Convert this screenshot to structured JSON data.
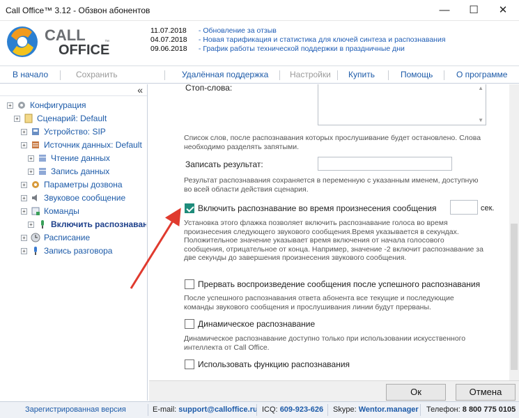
{
  "window": {
    "title": "Call Office™ 3.12 - Обзвон абонентов",
    "minimize_glyph": "—",
    "maximize_glyph": "☐",
    "close_glyph": "✕"
  },
  "logo": {
    "line1": "CALL",
    "line2": "OFFICE",
    "tm": "™"
  },
  "news": [
    {
      "date": "11.07.2018",
      "text": "Обновление за отзыв"
    },
    {
      "date": "04.07.2018",
      "text": "Новая тарификация и статистика для ключей синтеза и распознавания"
    },
    {
      "date": "09.06.2018",
      "text": "График работы технической поддержки в праздничные дни"
    }
  ],
  "menu": {
    "home": "В начало",
    "save": "Сохранить",
    "remote": "Удалённая поддержка",
    "settings": "Настройки",
    "buy": "Купить",
    "help": "Помощь",
    "about": "О программе"
  },
  "sidebar": {
    "collapse": "«",
    "items": [
      {
        "label": "Конфигурация"
      },
      {
        "label": "Сценарий: Default"
      },
      {
        "label": "Устройство: SIP"
      },
      {
        "label": "Источник данных: Default"
      },
      {
        "label": "Чтение данных"
      },
      {
        "label": "Запись данных"
      },
      {
        "label": "Параметры дозвона"
      },
      {
        "label": "Звуковое сообщение"
      },
      {
        "label": "Команды"
      },
      {
        "label": "Включить распознавание"
      },
      {
        "label": "Расписание"
      },
      {
        "label": "Запись разговора"
      }
    ]
  },
  "content": {
    "stopwords_label": "Стоп-слова:",
    "stopwords_help": "Список слов, после распознавания которых прослушивание будет остановлено. Слова необходимо разделять запятыми.",
    "write_result_label": "Записать результат:",
    "write_result_value": "",
    "write_result_help": "Результат распознавания сохраняется в переменную с указанным именем, доступную во всей области действия сценария.",
    "enable_label": "Включить распознавание во время произнесения сообщения",
    "enable_checked": true,
    "seconds_value": "",
    "seconds_unit": "сек.",
    "enable_help": "Установка этого флажка позволяет включить распознавание голоса во время произнесения следующего звукового сообщения.Время указывается в секундах. Положительное значение указывает время включения от начала голосового сообщения, отрицательное от конца. Например, значение -2 включит распознавание за две секунды до завершения произнесения звукового сообщения.",
    "interrupt_label": "Прервать воспроизведение сообщения после успешного распознавания",
    "interrupt_checked": false,
    "interrupt_help": "После успешного распознавания ответа абонента все текущие и последующие команды звукового сообщения и прослушивания линии будут прерваны.",
    "dynamic_label": "Динамическое распознавание",
    "dynamic_checked": false,
    "dynamic_help": "Динамическое распознавание доступно только при использовании искусственного интеллекта от Call Office.",
    "use_function_label": "Использовать функцию распознавания",
    "use_function_checked": false
  },
  "buttons": {
    "ok": "Ок",
    "cancel": "Отмена"
  },
  "status": {
    "registered": "Зарегистрированная версия",
    "email_label": "E-mail:",
    "email": "support@calloffice.ru",
    "icq_label": "ICQ:",
    "icq": "609-923-626",
    "skype_label": "Skype:",
    "skype": "Wentor.manager",
    "phone_label": "Телефон:",
    "phone": "8 800 775 0105"
  },
  "colors": {
    "accent": "#1c5aa8",
    "check": "#1e8c7b",
    "arrow": "#e03a2e"
  }
}
